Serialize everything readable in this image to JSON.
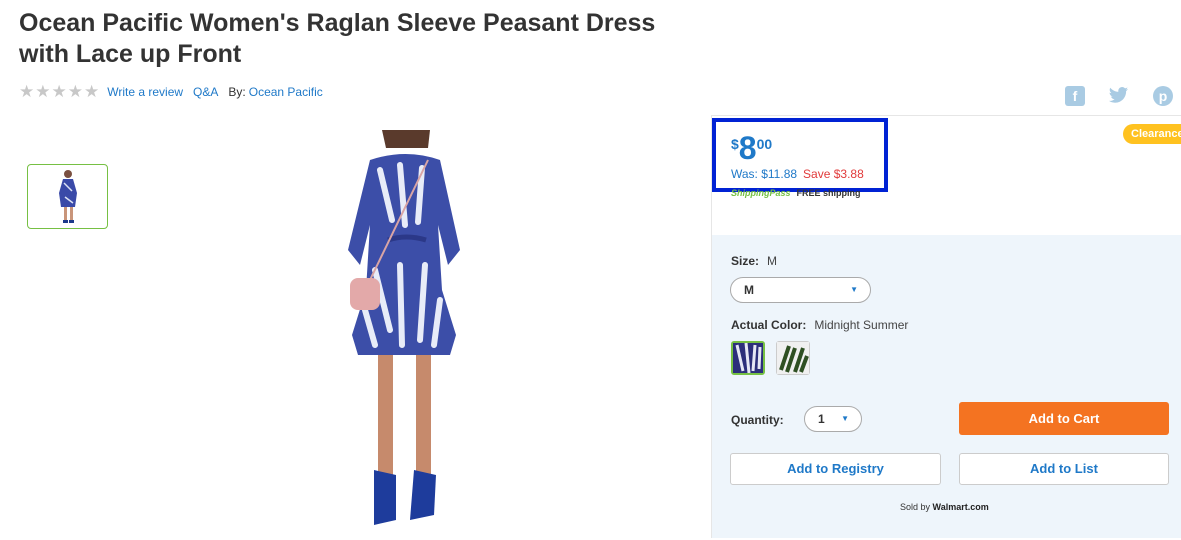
{
  "product": {
    "title": "Ocean Pacific Women's Raglan Sleeve Peasant Dress with Lace up Front",
    "review_link": "Write a review",
    "qa_link": "Q&A",
    "by_label": "By:",
    "brand": "Ocean Pacific"
  },
  "price": {
    "currency": "$",
    "dollars": "8",
    "cents": "00",
    "was": "Was: $11.88",
    "save": "Save $3.88",
    "badge": "Clearance"
  },
  "shipping": {
    "pass": "ShippingPass",
    "free": "FREE shipping"
  },
  "options": {
    "size_label": "Size:",
    "size_value": "M",
    "size_selected": "M",
    "color_label": "Actual Color:",
    "color_value": "Midnight Summer",
    "quantity_label": "Quantity:",
    "quantity_value": "1"
  },
  "actions": {
    "add_to_cart": "Add to Cart",
    "add_to_registry": "Add to Registry",
    "add_to_list": "Add to List",
    "sold_by_prefix": "Sold by",
    "sold_by_name": "Walmart.com"
  },
  "social": {
    "facebook": "f",
    "twitter": "✓",
    "pinterest": "p"
  },
  "colors": {
    "accent": "#1f79c8",
    "cart": "#f47321",
    "save": "#e13a3a",
    "highlight": "#0022d4",
    "badge": "#ffc220",
    "swatch_selected": "#76c043"
  }
}
